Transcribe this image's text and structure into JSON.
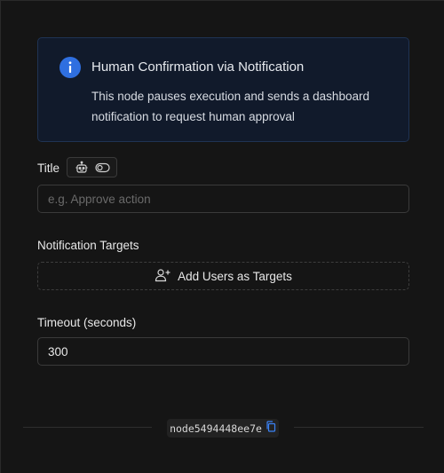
{
  "info": {
    "icon": "info-icon",
    "title": "Human Confirmation via Notification",
    "description": "This node pauses execution and sends a dashboard notification to request human approval",
    "accent_color": "#2f6fe0"
  },
  "title_field": {
    "label": "Title",
    "value": "",
    "placeholder": "e.g. Approve action",
    "ai_toggle_icons": [
      "robot-icon",
      "toggle-icon"
    ]
  },
  "targets": {
    "label": "Notification Targets",
    "button_label": "Add Users as Targets",
    "button_icon": "add-user-icon"
  },
  "timeout": {
    "label": "Timeout (seconds)",
    "value": "300"
  },
  "footer": {
    "node_id": "node5494448ee7e",
    "copy_icon": "copy-icon"
  }
}
